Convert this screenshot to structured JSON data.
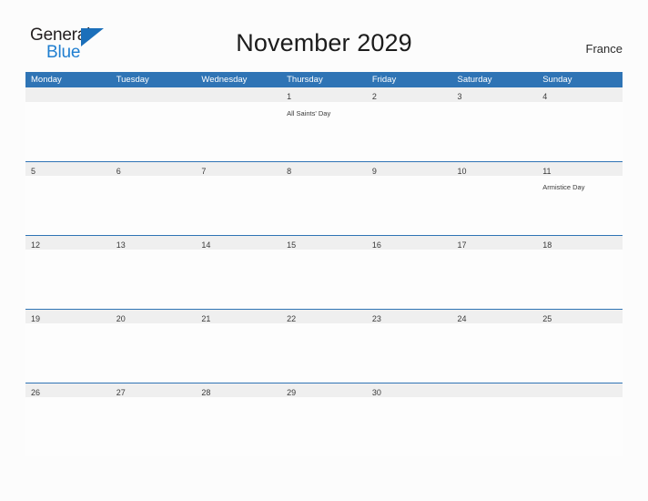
{
  "brand": {
    "name_part1": "General",
    "name_part2": "Blue",
    "triangle_color": "#1b6fba",
    "blue_text_color": "#1f7ed0"
  },
  "header": {
    "title": "November 2029",
    "country": "France"
  },
  "theme": {
    "header_blue": "#2f74b5",
    "date_band_gray": "#efefef",
    "page_background": "#fcfcfc",
    "text_color": "#3a3a3a"
  },
  "calendar": {
    "month": "November",
    "year": "2029",
    "weekday_headers": [
      "Monday",
      "Tuesday",
      "Wednesday",
      "Thursday",
      "Friday",
      "Saturday",
      "Sunday"
    ],
    "weeks": [
      [
        {
          "day": "",
          "event": ""
        },
        {
          "day": "",
          "event": ""
        },
        {
          "day": "",
          "event": ""
        },
        {
          "day": "1",
          "event": "All Saints' Day"
        },
        {
          "day": "2",
          "event": ""
        },
        {
          "day": "3",
          "event": ""
        },
        {
          "day": "4",
          "event": ""
        }
      ],
      [
        {
          "day": "5",
          "event": ""
        },
        {
          "day": "6",
          "event": ""
        },
        {
          "day": "7",
          "event": ""
        },
        {
          "day": "8",
          "event": ""
        },
        {
          "day": "9",
          "event": ""
        },
        {
          "day": "10",
          "event": ""
        },
        {
          "day": "11",
          "event": "Armistice Day"
        }
      ],
      [
        {
          "day": "12",
          "event": ""
        },
        {
          "day": "13",
          "event": ""
        },
        {
          "day": "14",
          "event": ""
        },
        {
          "day": "15",
          "event": ""
        },
        {
          "day": "16",
          "event": ""
        },
        {
          "day": "17",
          "event": ""
        },
        {
          "day": "18",
          "event": ""
        }
      ],
      [
        {
          "day": "19",
          "event": ""
        },
        {
          "day": "20",
          "event": ""
        },
        {
          "day": "21",
          "event": ""
        },
        {
          "day": "22",
          "event": ""
        },
        {
          "day": "23",
          "event": ""
        },
        {
          "day": "24",
          "event": ""
        },
        {
          "day": "25",
          "event": ""
        }
      ],
      [
        {
          "day": "26",
          "event": ""
        },
        {
          "day": "27",
          "event": ""
        },
        {
          "day": "28",
          "event": ""
        },
        {
          "day": "29",
          "event": ""
        },
        {
          "day": "30",
          "event": ""
        },
        {
          "day": "",
          "event": ""
        },
        {
          "day": "",
          "event": ""
        }
      ]
    ],
    "holidays": [
      {
        "date": "1",
        "weekday": "Thursday",
        "name": "All Saints' Day"
      },
      {
        "date": "11",
        "weekday": "Sunday",
        "name": "Armistice Day"
      }
    ]
  }
}
